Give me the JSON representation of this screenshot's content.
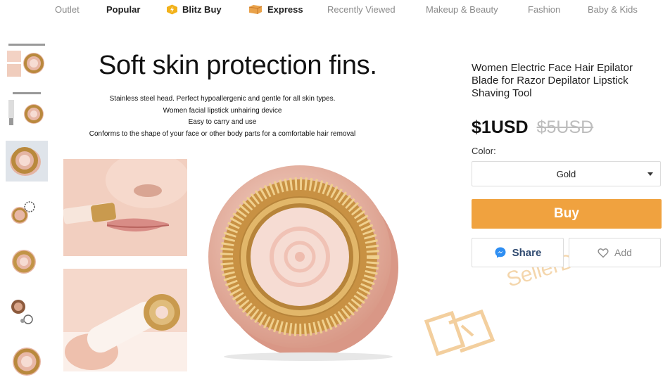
{
  "nav": {
    "items": [
      {
        "label": "Outlet",
        "bold": false,
        "icon": null
      },
      {
        "label": "Popular",
        "bold": true,
        "icon": null
      },
      {
        "label": "Blitz Buy",
        "bold": true,
        "icon": "lightning-badge-icon"
      },
      {
        "label": "Express",
        "bold": true,
        "icon": "express-box-icon"
      },
      {
        "label": "Recently Viewed",
        "bold": false,
        "icon": null
      },
      {
        "label": "Makeup & Beauty",
        "bold": false,
        "icon": null
      },
      {
        "label": "Fashion",
        "bold": false,
        "icon": null
      },
      {
        "label": "Baby & Kids",
        "bold": false,
        "icon": null
      }
    ]
  },
  "gallery": {
    "thumbnail_count": 8,
    "active_index": 2,
    "main": {
      "headline": "Soft skin protection fins.",
      "features": [
        "Stainless steel head. Perfect hypoallergenic and gentle for all skin types.",
        "Women facial lipstick unhairing device",
        "Easy to carry and use",
        "Conforms to the shape of your face or other body parts for a comfortable hair removal"
      ]
    }
  },
  "product": {
    "title": "Women Electric Face Hair Epilator Blade for Razor Depilator Lipstick Shaving Tool",
    "price": "$1USD",
    "original_price": "$5USD",
    "color_label": "Color:",
    "selected_color": "Gold",
    "buy_label": "Buy",
    "share_label": "Share",
    "add_label": "Add"
  },
  "watermark": {
    "text": "SellerDefense"
  },
  "colors": {
    "buy_orange": "#f0a23f",
    "share_text": "#2f4a70",
    "messenger_blue": "#2e8ef2",
    "watermark": "#f3cf9e",
    "rose_gold": "#e8b7a6",
    "gold": "#b9893d"
  }
}
